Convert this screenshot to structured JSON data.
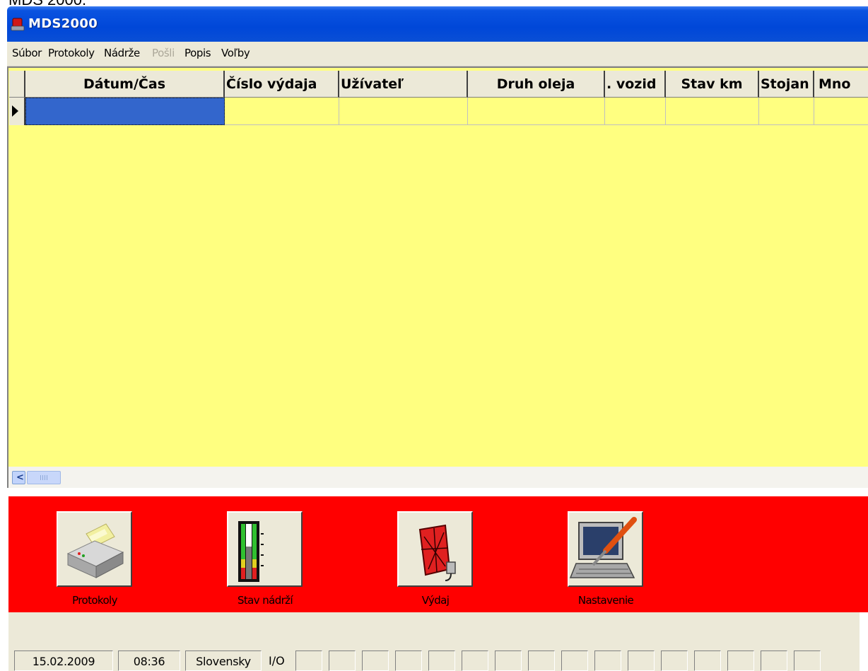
{
  "caption": "MDS 2000.",
  "window": {
    "title": "MDS2000",
    "title_color": "#0047d8"
  },
  "menu": [
    {
      "label": "Súbor",
      "enabled": true
    },
    {
      "label": "Protokoly",
      "enabled": true
    },
    {
      "label": "Nádrže",
      "enabled": true
    },
    {
      "label": "Pošli",
      "enabled": false
    },
    {
      "label": "Popis",
      "enabled": true
    },
    {
      "label": "Voľby",
      "enabled": true
    }
  ],
  "grid": {
    "background": "#ffff80",
    "selected_cell_color": "#3366cc",
    "columns": [
      {
        "label": "Dátum/Čas"
      },
      {
        "label": "Číslo výdaja"
      },
      {
        "label": "Užívateľ"
      },
      {
        "label": "Druh oleja"
      },
      {
        "label": ". vozid"
      },
      {
        "label": "Stav km"
      },
      {
        "label": "Stojan"
      },
      {
        "label": "Mno"
      }
    ]
  },
  "panel": {
    "background": "#ff0000",
    "buttons": [
      {
        "label": "Protokoly",
        "icon": "printer-icon"
      },
      {
        "label": "Stav nádrží",
        "icon": "tank-level-icon"
      },
      {
        "label": "Výdaj",
        "icon": "dispenser-icon"
      },
      {
        "label": "Nastavenie",
        "icon": "settings-computer-icon"
      }
    ]
  },
  "status": {
    "date": "15.02.2009",
    "time": "08:36",
    "language": "Slovensky",
    "io_label": "I/O"
  }
}
